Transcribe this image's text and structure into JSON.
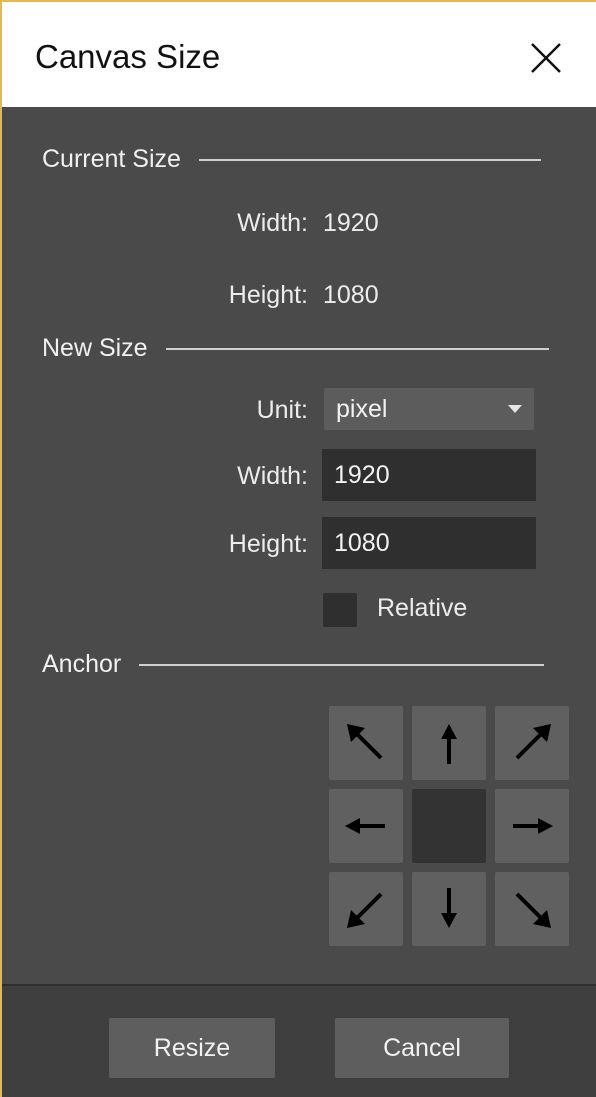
{
  "dialog": {
    "title": "Canvas Size",
    "close_icon": "close-icon"
  },
  "current_size": {
    "heading": "Current Size",
    "width_label": "Width:",
    "width_value": "1920",
    "height_label": "Height:",
    "height_value": "1080"
  },
  "new_size": {
    "heading": "New Size",
    "unit_label": "Unit:",
    "unit_value": "pixel",
    "width_label": "Width:",
    "width_value": "1920",
    "height_label": "Height:",
    "height_value": "1080",
    "relative_label": "Relative",
    "relative_checked": false
  },
  "anchor": {
    "heading": "Anchor",
    "selected": "center",
    "icons": [
      "arrow-up-left-icon",
      "arrow-up-icon",
      "arrow-up-right-icon",
      "arrow-left-icon",
      "arrow-right-icon",
      "arrow-down-left-icon",
      "arrow-down-icon",
      "arrow-down-right-icon"
    ]
  },
  "footer": {
    "resize_label": "Resize",
    "cancel_label": "Cancel"
  },
  "colors": {
    "dialog_background": "#4a4a4a",
    "input_background": "#2f2f2f",
    "window_border_accent": "#e8b84a"
  }
}
